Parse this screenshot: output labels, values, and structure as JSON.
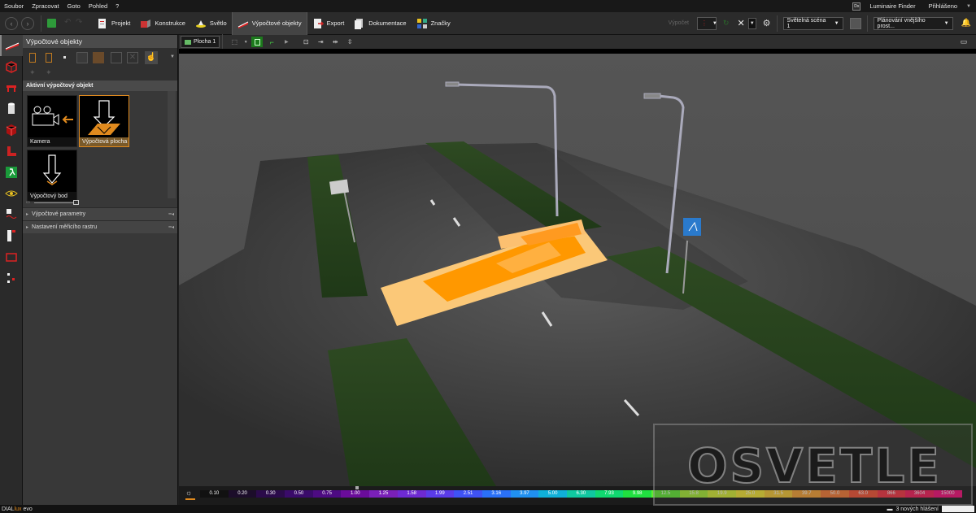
{
  "menu": {
    "items": [
      "Soubor",
      "Zpracovat",
      "Goto",
      "Pohled",
      "?"
    ],
    "luminaire_finder": "Luminaire Finder",
    "login": "Přihlášeno",
    "dx_badge": "Dx"
  },
  "toolbar": {
    "tabs": [
      {
        "label": "Projekt",
        "icon": "project-icon"
      },
      {
        "label": "Konstrukce",
        "icon": "construction-icon"
      },
      {
        "label": "Světlo",
        "icon": "light-icon"
      },
      {
        "label": "Výpočtové objekty",
        "icon": "calc-objects-icon",
        "active": true
      },
      {
        "label": "Export",
        "icon": "export-icon"
      },
      {
        "label": "Dokumentace",
        "icon": "documentation-icon"
      },
      {
        "label": "Značky",
        "icon": "marks-icon"
      }
    ],
    "calc_label": "Výpočet",
    "scene_label": "Světelná scéna 1",
    "planning_label": "Plánování vnějšího prost..."
  },
  "panel": {
    "title": "Výpočtové objekty",
    "active_section": "Aktivní výpočtový objekt",
    "objects": [
      {
        "label": "Kamera",
        "selected": false
      },
      {
        "label": "Výpočtová plocha",
        "selected": true
      },
      {
        "label": "Výpočtový bod",
        "selected": false
      }
    ],
    "sections": [
      "Výpočtové parametry",
      "Nastavení měřicího rastru"
    ]
  },
  "view": {
    "tab_label": "Plocha 1"
  },
  "legend": {
    "values": [
      "0.10",
      "0.20",
      "0.30",
      "0.50",
      "0.75",
      "1.00",
      "1.25",
      "1.58",
      "1.99",
      "2.51",
      "3.16",
      "3.97",
      "5.00",
      "6.30",
      "7.93",
      "9.98",
      "12.5",
      "15.8",
      "19.9",
      "25.0",
      "31.5",
      "39.7",
      "50.0",
      "63.0",
      "866",
      "3604",
      "15000"
    ],
    "colors": [
      "#111111",
      "#1c0d2a",
      "#2b0b4a",
      "#3a0b6a",
      "#4d0b82",
      "#6a0c9a",
      "#7a20b8",
      "#6e2ad2",
      "#5a3be8",
      "#3f52f4",
      "#2a70f8",
      "#2090f0",
      "#10b0d8",
      "#10c8a0",
      "#10d870",
      "#20e040",
      "#60ec30",
      "#a8f030",
      "#d8f030",
      "#f8e830",
      "#f8c830",
      "#f8a030",
      "#f87830",
      "#f85030",
      "#f83040",
      "#f81858",
      "#f80878"
    ]
  },
  "status": {
    "brand_prefix": "DIAL",
    "brand_lux": "lux",
    "brand_suffix": " evo",
    "messages": "3 nových hlášení"
  },
  "watermark": {
    "text": "OSVETLE"
  }
}
